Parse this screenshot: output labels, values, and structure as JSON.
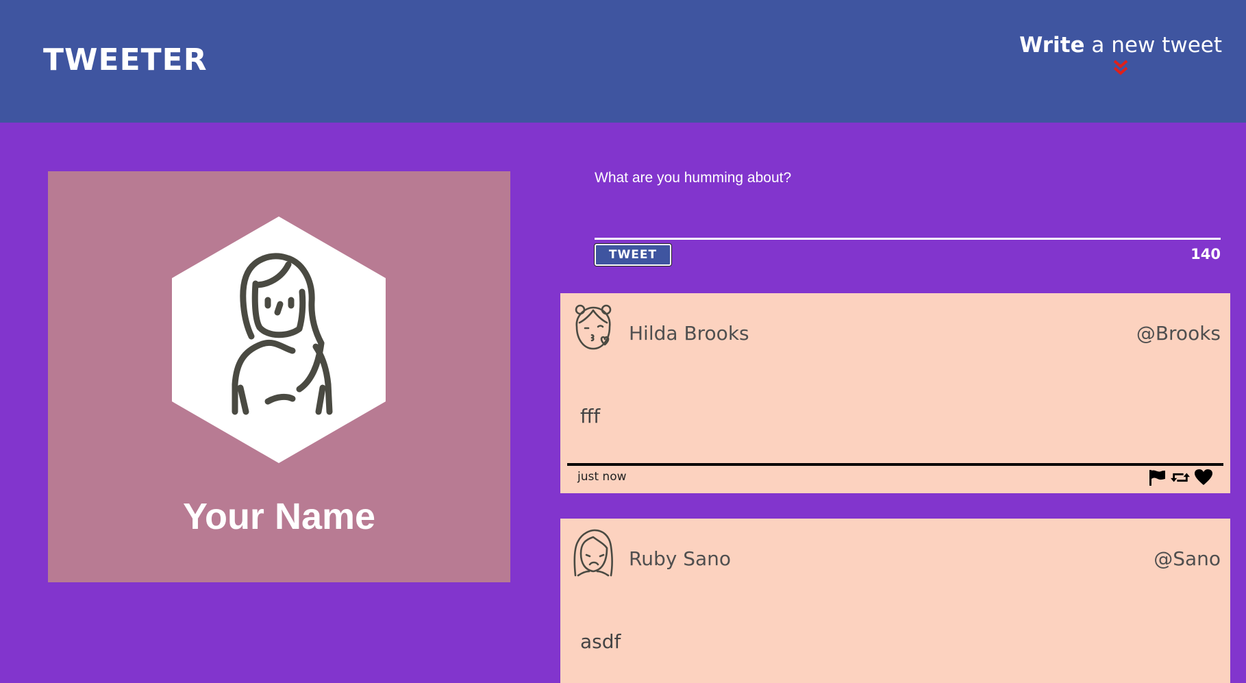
{
  "header": {
    "brand": "TWEETER",
    "compose_bold": "Write",
    "compose_rest": " a new tweet",
    "chevron_icon": "double-chevron-down-icon",
    "chevron_color": "#e0201a"
  },
  "profile": {
    "name": "Your Name",
    "avatar_icon": "user-avatar-icon"
  },
  "compose": {
    "placeholder": "What are you humming about?",
    "value": "",
    "button_label": "TWEET",
    "counter": "140"
  },
  "tweets": [
    {
      "name": "Hilda Brooks",
      "handle": "@Brooks",
      "content": "fff",
      "time": "just now",
      "avatar_icon": "girl-kiss-avatar-icon",
      "actions": [
        "flag-icon",
        "retweet-icon",
        "heart-icon"
      ]
    },
    {
      "name": "Ruby Sano",
      "handle": "@Sano",
      "content": "asdf",
      "avatar_icon": "girl-sad-avatar-icon"
    }
  ],
  "colors": {
    "nav": "#3f55a0",
    "page": "#8235cd",
    "profile_card": "#b87b93",
    "tweet_card": "#fcd2bf"
  }
}
